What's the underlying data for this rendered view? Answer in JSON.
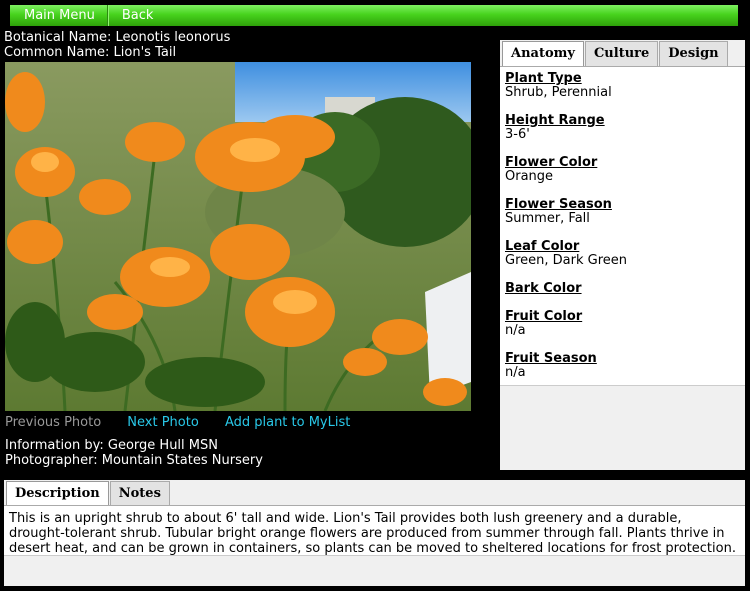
{
  "menu": {
    "main_menu": "Main Menu",
    "back": "Back"
  },
  "plant": {
    "botanical_label": "Botanical Name: Leonotis leonorus",
    "common_label": "Common Name: Lion's Tail"
  },
  "photo_nav": {
    "previous": "Previous Photo",
    "next": "Next Photo",
    "add": "Add plant to MyList"
  },
  "credits": {
    "info_by": "Information by: George Hull MSN",
    "photographer": "Photographer: Mountain States Nursery"
  },
  "side_tabs": [
    "Anatomy",
    "Culture",
    "Design"
  ],
  "anatomy": [
    {
      "label": "Plant Type",
      "value": "Shrub, Perennial"
    },
    {
      "label": "Height Range",
      "value": "3-6'"
    },
    {
      "label": "Flower Color",
      "value": "Orange"
    },
    {
      "label": "Flower Season",
      "value": "Summer, Fall"
    },
    {
      "label": "Leaf Color",
      "value": "Green, Dark Green"
    },
    {
      "label": "Bark Color",
      "value": ""
    },
    {
      "label": "Fruit Color",
      "value": "n/a"
    },
    {
      "label": "Fruit Season",
      "value": "n/a"
    }
  ],
  "bottom_tabs": [
    "Description",
    "Notes"
  ],
  "description": "This is an upright shrub to about 6' tall and wide. Lion's Tail provides both lush greenery and a durable, drought-tolerant shrub. Tubular bright orange flowers are produced from summer through fall. Plants thrive in desert heat, and can be grown in containers, so plants can be moved to sheltered locations for frost protection.",
  "colors": {
    "nav_link": "#29c8e8",
    "menu_bar": "#47d31d",
    "flower": "#f08a1c"
  }
}
